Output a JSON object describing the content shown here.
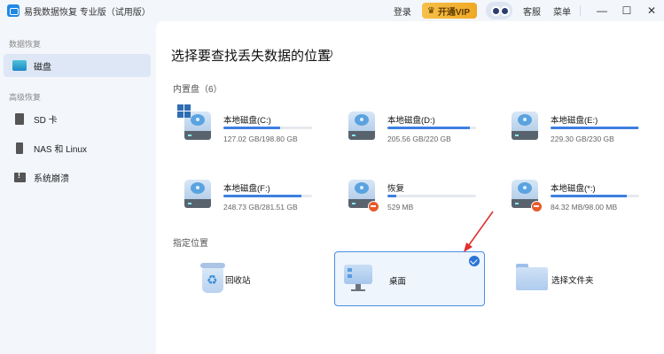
{
  "titlebar": {
    "app_title": "易我数据恢复 专业版（试用版）",
    "login": "登录",
    "vip": "开通VIP",
    "support": "客服",
    "menu": "菜单",
    "minimize": "—",
    "maximize": "☐",
    "close": "✕"
  },
  "sidebar": {
    "section1": "数据恢复",
    "items1": [
      {
        "label": "磁盘",
        "icon": "disk-icon"
      }
    ],
    "section2": "高级恢复",
    "items2": [
      {
        "label": "SD 卡",
        "icon": "sd-card-icon"
      },
      {
        "label": "NAS 和 Linux",
        "icon": "nas-icon"
      },
      {
        "label": "系统崩溃",
        "icon": "system-crash-icon"
      }
    ]
  },
  "main": {
    "title": "选择要查找丢失数据的位置",
    "internal_label": "内置盘（6）",
    "disks": [
      {
        "name": "本地磁盘(C:)",
        "size": "127.02 GB/198.80 GB",
        "used_fraction": 0.64,
        "badge": "windows-logo"
      },
      {
        "name": "本地磁盘(D:)",
        "size": "205.56 GB/220 GB",
        "used_fraction": 0.93,
        "badge": ""
      },
      {
        "name": "本地磁盘(E:)",
        "size": "229.30 GB/230 GB",
        "used_fraction": 0.99,
        "badge": ""
      },
      {
        "name": "本地磁盘(F:)",
        "size": "248.73 GB/281.51 GB",
        "used_fraction": 0.88,
        "badge": ""
      },
      {
        "name": "恢复",
        "size": "529 MB",
        "used_fraction": 0.1,
        "badge": "minus"
      },
      {
        "name": "本地磁盘(*:)",
        "size": "84.32 MB/98.00 MB",
        "used_fraction": 0.86,
        "badge": "minus"
      }
    ],
    "location_label": "指定位置",
    "locations": [
      {
        "name": "回收站",
        "icon": "recycle-bin-icon",
        "selected": false
      },
      {
        "name": "桌面",
        "icon": "desktop-icon",
        "selected": true
      },
      {
        "name": "选择文件夹",
        "icon": "folder-icon",
        "selected": false
      }
    ]
  },
  "colors": {
    "accent": "#2a73d6",
    "bar_fill": "#3d7fe0",
    "vip_gold": "#f0a824",
    "arrow_red": "#e03030"
  }
}
